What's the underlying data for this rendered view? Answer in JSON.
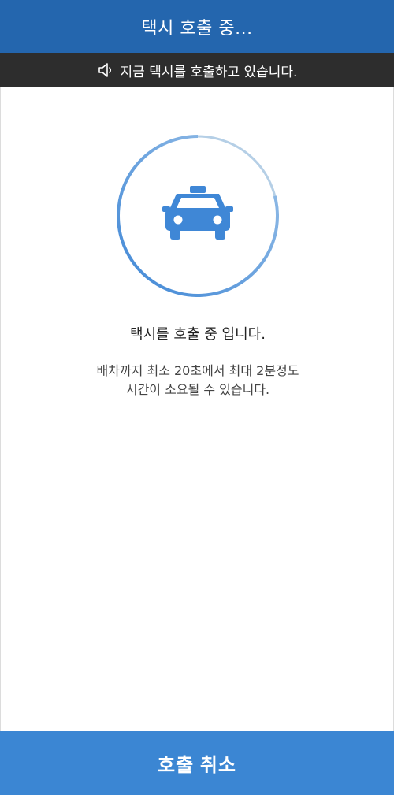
{
  "header": {
    "title": "택시 호출 중..."
  },
  "notice": {
    "text": "지금 택시를 호출하고 있습니다.",
    "icon": "speaker-icon"
  },
  "status": {
    "title": "택시를 호출 중 입니다.",
    "description_line1": "배차까지 최소 20초에서 최대 2분정도",
    "description_line2": "시간이 소요될 수 있습니다.",
    "icon": "taxi-icon",
    "progress": 0.79
  },
  "cancel": {
    "label": "호출 취소"
  },
  "colors": {
    "header_bg": "#2466AE",
    "notice_bg": "#2D2D2D",
    "accent": "#3F87D6",
    "ring_track": "#B5CFE6",
    "button_bg": "#3B86D3"
  }
}
